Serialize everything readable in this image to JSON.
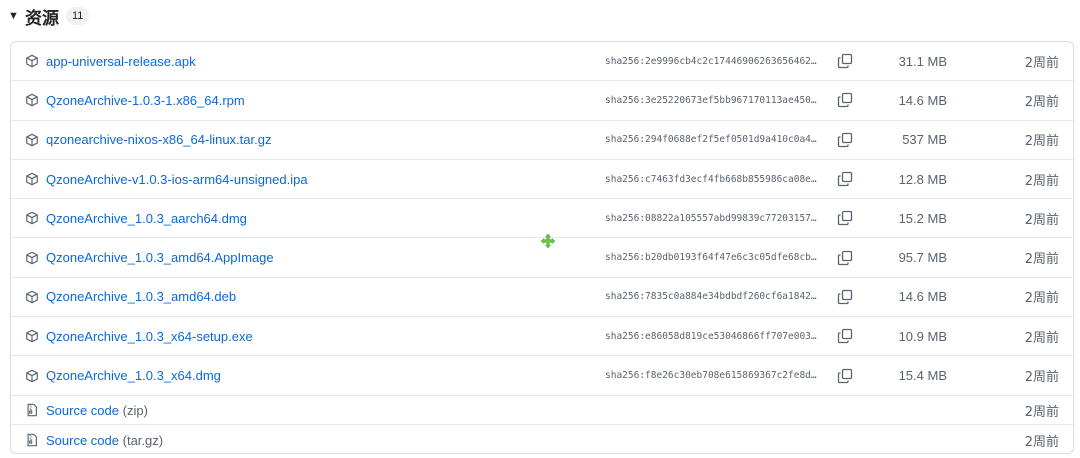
{
  "section": {
    "title": "资源",
    "count": "11"
  },
  "assets": [
    {
      "name": "app-universal-release.apk",
      "sha": "sha256:2e9996cb4c2c17446906263656462…",
      "size": "31.1 MB",
      "time": "2周前"
    },
    {
      "name": "QzoneArchive-1.0.3-1.x86_64.rpm",
      "sha": "sha256:3e25220673ef5bb967170113ae450…",
      "size": "14.6 MB",
      "time": "2周前"
    },
    {
      "name": "qzonearchive-nixos-x86_64-linux.tar.gz",
      "sha": "sha256:294f0688ef2f5ef0501d9a410c0a4…",
      "size": "537 MB",
      "time": "2周前"
    },
    {
      "name": "QzoneArchive-v1.0.3-ios-arm64-unsigned.ipa",
      "sha": "sha256:c7463fd3ecf4fb668b855986ca08e…",
      "size": "12.8 MB",
      "time": "2周前"
    },
    {
      "name": "QzoneArchive_1.0.3_aarch64.dmg",
      "sha": "sha256:08822a105557abd99839c77203157…",
      "size": "15.2 MB",
      "time": "2周前"
    },
    {
      "name": "QzoneArchive_1.0.3_amd64.AppImage",
      "sha": "sha256:b20db0193f64f47e6c3c05dfe68cb…",
      "size": "95.7 MB",
      "time": "2周前"
    },
    {
      "name": "QzoneArchive_1.0.3_amd64.deb",
      "sha": "sha256:7835c0a884e34bdbdf260cf6a1842…",
      "size": "14.6 MB",
      "time": "2周前"
    },
    {
      "name": "QzoneArchive_1.0.3_x64-setup.exe",
      "sha": "sha256:e86058d819ce53046866ff707e003…",
      "size": "10.9 MB",
      "time": "2周前"
    },
    {
      "name": "QzoneArchive_1.0.3_x64.dmg",
      "sha": "sha256:f8e26c30eb708e615869367c2fe8d…",
      "size": "15.4 MB",
      "time": "2周前"
    }
  ],
  "sources": [
    {
      "name": "Source code",
      "ext": "(zip)",
      "time": "2周前"
    },
    {
      "name": "Source code",
      "ext": "(tar.gz)",
      "time": "2周前"
    }
  ],
  "colors": {
    "link": "#0969da",
    "muted": "#59636e",
    "border": "#d8dee4",
    "cursor": "#6cc644"
  },
  "icons": {
    "asset": "package-icon",
    "source": "file-zip-icon",
    "copy": "copy-icon",
    "toggle": "triangle-down-icon",
    "cursor": "move-cursor-icon"
  }
}
